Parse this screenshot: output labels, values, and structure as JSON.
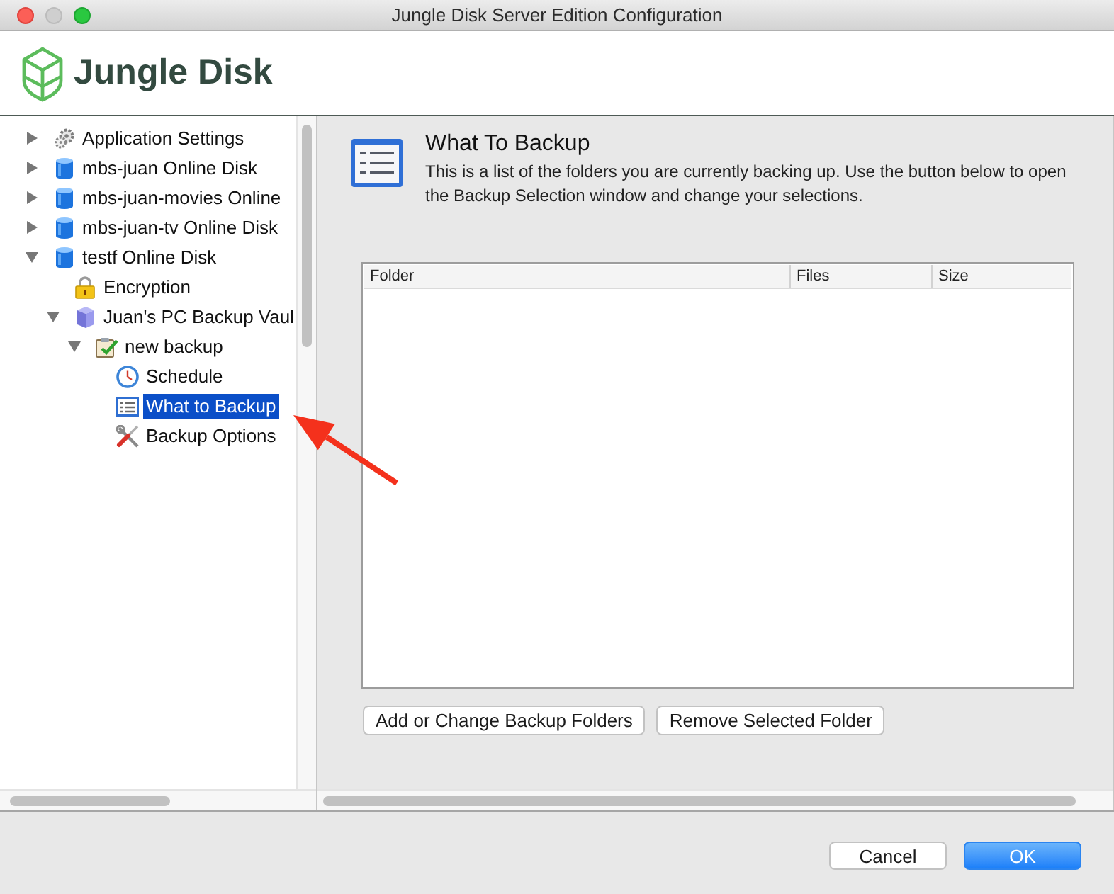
{
  "window": {
    "title": "Jungle Disk Server Edition Configuration"
  },
  "header": {
    "logo_text": "Jungle Disk"
  },
  "tree": {
    "items": [
      {
        "label": "Application Settings",
        "kind": "gears",
        "expanded": false,
        "selected": false
      },
      {
        "label": "mbs-juan Online Disk",
        "kind": "disk",
        "expanded": false,
        "selected": false
      },
      {
        "label": "mbs-juan-movies Online",
        "kind": "disk",
        "expanded": false,
        "selected": false
      },
      {
        "label": "mbs-juan-tv Online Disk",
        "kind": "disk",
        "expanded": false,
        "selected": false
      },
      {
        "label": "testf Online Disk",
        "kind": "disk",
        "expanded": true,
        "selected": false,
        "children": [
          {
            "label": "Encryption",
            "kind": "lock",
            "selected": false
          },
          {
            "label": "Juan's PC Backup Vaul",
            "kind": "vault",
            "expanded": true,
            "selected": false,
            "children": [
              {
                "label": "new backup",
                "kind": "backup",
                "expanded": true,
                "selected": false,
                "children": [
                  {
                    "label": "Schedule",
                    "kind": "clock",
                    "selected": false
                  },
                  {
                    "label": "What to Backup",
                    "kind": "list",
                    "selected": true
                  },
                  {
                    "label": "Backup Options",
                    "kind": "tools",
                    "selected": false
                  }
                ]
              }
            ]
          }
        ]
      }
    ]
  },
  "panel": {
    "title": "What To Backup",
    "description": "This is a list of the folders you are currently backing up. Use the button below to open the Backup Selection window and change your selections.",
    "table": {
      "columns": [
        "Folder",
        "Files",
        "Size"
      ]
    },
    "buttons": [
      "Add or Change Backup Folders",
      "Remove Selected Folder"
    ]
  },
  "footer": {
    "buttons": [
      {
        "label": "Cancel",
        "default": false
      },
      {
        "label": "OK",
        "default": true
      }
    ]
  }
}
